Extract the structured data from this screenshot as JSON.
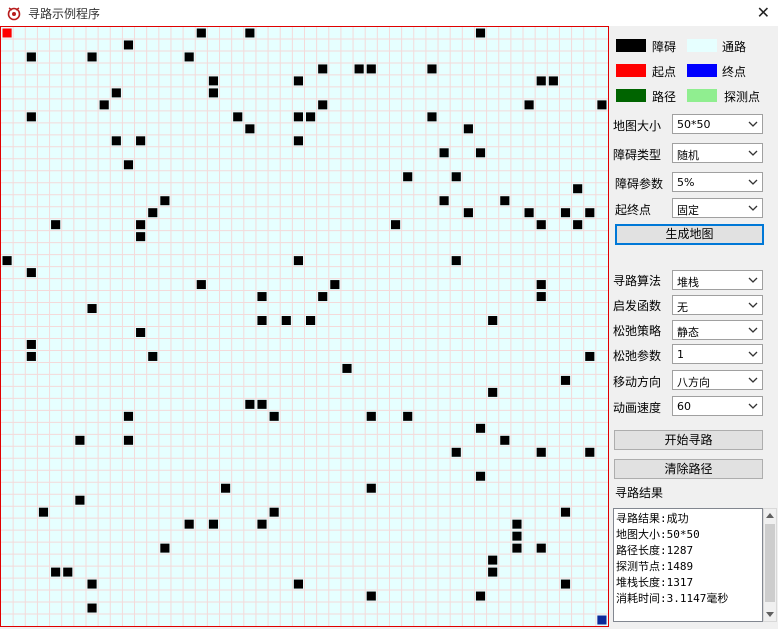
{
  "window": {
    "title": "寻路示例程序",
    "close_glyph": "✕"
  },
  "legend": [
    {
      "label": "障碍",
      "color": "#000000"
    },
    {
      "label": "通路",
      "color": "#e6ffff"
    },
    {
      "label": "起点",
      "color": "#ff0000"
    },
    {
      "label": "终点",
      "color": "#0000ff"
    },
    {
      "label": "路径",
      "color": "#006400"
    },
    {
      "label": "探测点",
      "color": "#90ee90"
    }
  ],
  "map_settings": {
    "size_label": "地图大小",
    "size_value": "50*50",
    "obstacle_type_label": "障碍类型",
    "obstacle_type_value": "随机",
    "obstacle_param_label": "障碍参数",
    "obstacle_param_value": "5%",
    "endpoints_label": "起终点",
    "endpoints_value": "固定",
    "generate_button": "生成地图"
  },
  "search_settings": {
    "algorithm_label": "寻路算法",
    "algorithm_value": "堆栈",
    "heuristic_label": "启发函数",
    "heuristic_value": "无",
    "relax_strategy_label": "松弛策略",
    "relax_strategy_value": "静态",
    "relax_param_label": "松弛参数",
    "relax_param_value": "1",
    "move_dir_label": "移动方向",
    "move_dir_value": "八方向",
    "anim_speed_label": "动画速度",
    "anim_speed_value": "60"
  },
  "actions": {
    "start_button": "开始寻路",
    "clear_button": "清除路径"
  },
  "result": {
    "title": "寻路结果",
    "lines": [
      "寻路结果:成功",
      "地图大小:50*50",
      "路径长度:1287",
      "探测节点:1489",
      "堆栈长度:1317",
      "消耗时间:3.1147毫秒"
    ]
  },
  "map": {
    "rows": 50,
    "cols": 50,
    "obstacle_color": "#000000",
    "floor_color": "#e6ffff",
    "grid_color": "#f4dada",
    "start": [
      0,
      0
    ],
    "end": [
      49,
      49
    ],
    "start_color": "#ff0000",
    "end_color": "#0b2a9a",
    "obstacles": [
      [
        0,
        16
      ],
      [
        0,
        20
      ],
      [
        0,
        39
      ],
      [
        1,
        10
      ],
      [
        2,
        2
      ],
      [
        2,
        7
      ],
      [
        2,
        15
      ],
      [
        3,
        26
      ],
      [
        3,
        29
      ],
      [
        3,
        30
      ],
      [
        3,
        35
      ],
      [
        4,
        17
      ],
      [
        4,
        24
      ],
      [
        4,
        44
      ],
      [
        4,
        45
      ],
      [
        5,
        9
      ],
      [
        5,
        17
      ],
      [
        6,
        8
      ],
      [
        6,
        26
      ],
      [
        6,
        43
      ],
      [
        6,
        49
      ],
      [
        7,
        2
      ],
      [
        7,
        19
      ],
      [
        7,
        24
      ],
      [
        7,
        25
      ],
      [
        7,
        35
      ],
      [
        8,
        20
      ],
      [
        8,
        38
      ],
      [
        9,
        9
      ],
      [
        9,
        11
      ],
      [
        9,
        24
      ],
      [
        10,
        36
      ],
      [
        10,
        39
      ],
      [
        11,
        10
      ],
      [
        12,
        33
      ],
      [
        12,
        37
      ],
      [
        13,
        47
      ],
      [
        14,
        13
      ],
      [
        14,
        36
      ],
      [
        14,
        41
      ],
      [
        15,
        12
      ],
      [
        15,
        38
      ],
      [
        15,
        43
      ],
      [
        15,
        46
      ],
      [
        15,
        48
      ],
      [
        16,
        4
      ],
      [
        16,
        11
      ],
      [
        16,
        32
      ],
      [
        16,
        44
      ],
      [
        16,
        47
      ],
      [
        17,
        11
      ],
      [
        19,
        0
      ],
      [
        19,
        24
      ],
      [
        19,
        37
      ],
      [
        20,
        2
      ],
      [
        21,
        16
      ],
      [
        21,
        27
      ],
      [
        21,
        44
      ],
      [
        22,
        21
      ],
      [
        22,
        26
      ],
      [
        22,
        44
      ],
      [
        23,
        7
      ],
      [
        24,
        21
      ],
      [
        24,
        23
      ],
      [
        24,
        25
      ],
      [
        24,
        40
      ],
      [
        25,
        11
      ],
      [
        26,
        2
      ],
      [
        27,
        2
      ],
      [
        27,
        12
      ],
      [
        27,
        48
      ],
      [
        28,
        28
      ],
      [
        29,
        46
      ],
      [
        30,
        40
      ],
      [
        31,
        20
      ],
      [
        31,
        21
      ],
      [
        32,
        10
      ],
      [
        32,
        22
      ],
      [
        32,
        30
      ],
      [
        32,
        33
      ],
      [
        33,
        39
      ],
      [
        34,
        6
      ],
      [
        34,
        10
      ],
      [
        34,
        41
      ],
      [
        35,
        37
      ],
      [
        35,
        44
      ],
      [
        35,
        48
      ],
      [
        37,
        39
      ],
      [
        38,
        18
      ],
      [
        38,
        30
      ],
      [
        39,
        6
      ],
      [
        40,
        3
      ],
      [
        40,
        22
      ],
      [
        40,
        46
      ],
      [
        41,
        15
      ],
      [
        41,
        17
      ],
      [
        41,
        21
      ],
      [
        41,
        42
      ],
      [
        42,
        42
      ],
      [
        43,
        13
      ],
      [
        43,
        42
      ],
      [
        43,
        44
      ],
      [
        44,
        40
      ],
      [
        45,
        4
      ],
      [
        45,
        5
      ],
      [
        45,
        40
      ],
      [
        46,
        7
      ],
      [
        46,
        24
      ],
      [
        46,
        46
      ],
      [
        47,
        30
      ],
      [
        47,
        39
      ],
      [
        48,
        7
      ]
    ]
  }
}
